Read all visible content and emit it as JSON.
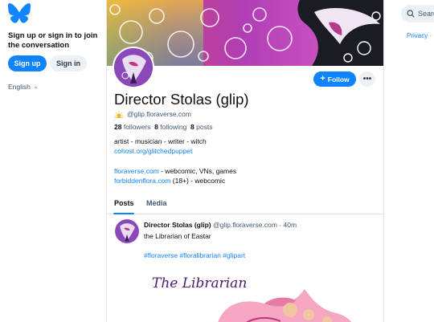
{
  "sidebar": {
    "signup_prompt": "Sign up or sign in to join the conversation",
    "signup_label": "Sign up",
    "signin_label": "Sign in",
    "language": "English"
  },
  "profile": {
    "display_name": "Director Stolas (glip)",
    "handle": "@glip.floraverse.com",
    "followers_count": "28",
    "followers_label": "followers",
    "following_count": "8",
    "following_label": "following",
    "posts_count": "8",
    "posts_label": "posts",
    "bio_line1": "artist - musician - writer - witch",
    "bio_link1": "cohost.org/glitchedpuppet",
    "bio_link2": "floraverse.com",
    "bio_line3_rest": " - webcomic, VNs, games",
    "bio_link3": "forbiddenflora.com",
    "bio_line4_rest": " (18+) - webcomic",
    "follow_label": "Follow",
    "more_icon": "more-icon"
  },
  "tabs": {
    "posts": "Posts",
    "media": "Media"
  },
  "post": {
    "author": "Director Stolas (glip)",
    "handle": "@glip.floraverse.com",
    "separator": " · ",
    "time": "40m",
    "text": "the Librarian of Eastar",
    "tags": "#floraverse #floralibrarian #glipart",
    "image_title": "The Librarian"
  },
  "right": {
    "search_placeholder": "Search",
    "links": "Privacy ·"
  },
  "colors": {
    "accent": "#1083fe",
    "secondary_text": "#42576c",
    "border": "#dfe4ea"
  }
}
